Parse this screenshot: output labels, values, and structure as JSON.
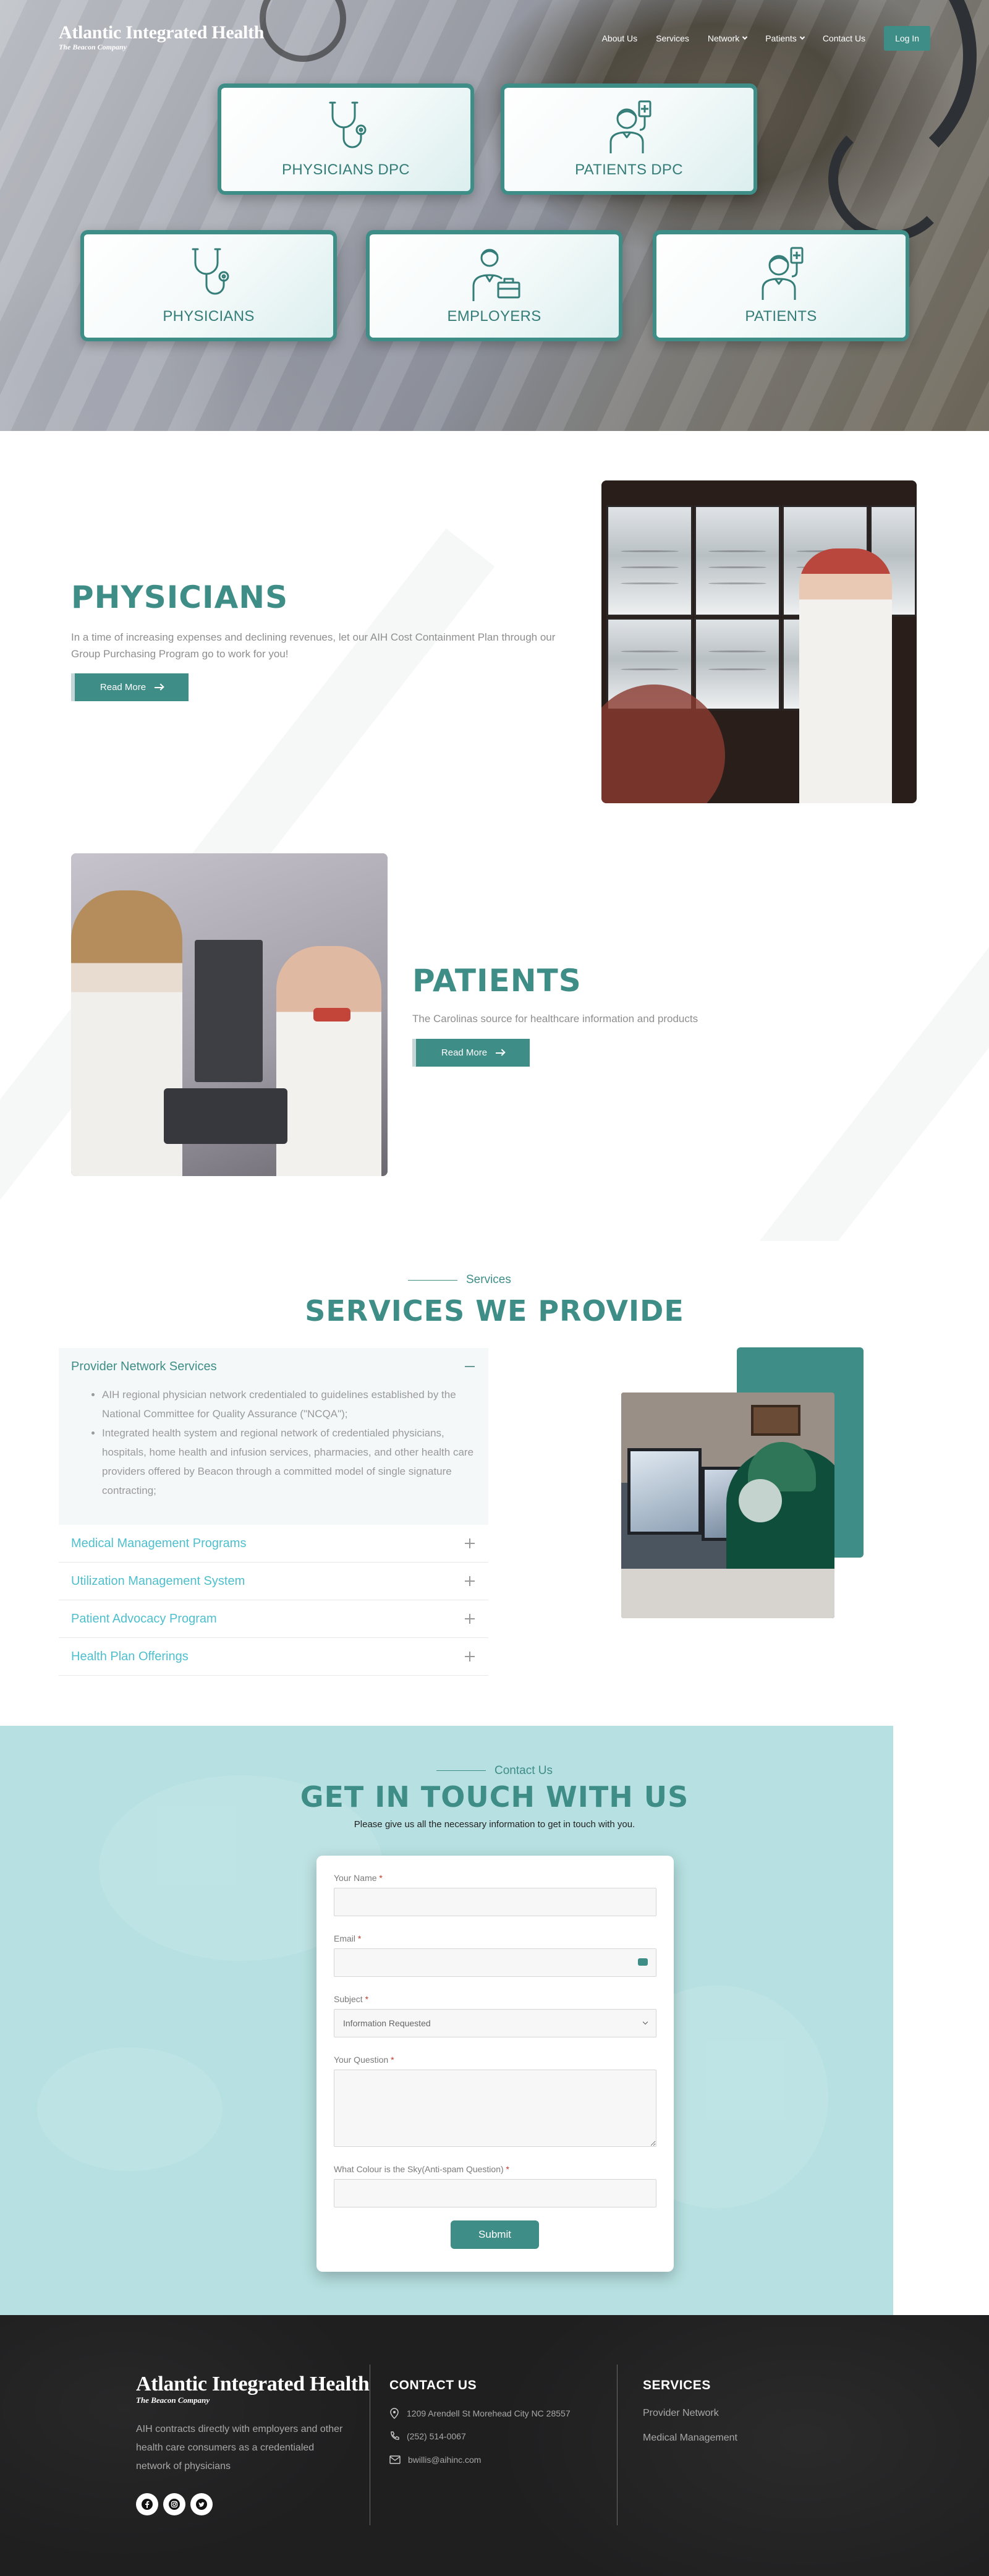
{
  "brand": {
    "name": "Atlantic Integrated Health",
    "tagline": "The Beacon Company"
  },
  "nav": {
    "items": [
      {
        "label": "About Us"
      },
      {
        "label": "Services"
      },
      {
        "label": "Network"
      },
      {
        "label": "Patients"
      },
      {
        "label": "Contact Us"
      }
    ],
    "login_label": "Log In"
  },
  "hero": {
    "cards": [
      {
        "label": "PHYSICIANS DPC",
        "icon": "stethoscope-icon"
      },
      {
        "label": "PATIENTS DPC",
        "icon": "patient-iv-icon"
      },
      {
        "label": "PHYSICIANS",
        "icon": "stethoscope-icon"
      },
      {
        "label": "EMPLOYERS",
        "icon": "employer-briefcase-icon"
      },
      {
        "label": "PATIENTS",
        "icon": "patient-iv-icon"
      }
    ]
  },
  "physicians": {
    "title": "PHYSICIANS",
    "text": "In a time of increasing expenses and declining revenues, let our AIH Cost Containment Plan through our Group Purchasing Program go to work for you!",
    "button": "Read More"
  },
  "patients": {
    "title": "PATIENTS",
    "text": "The Carolinas source for healthcare information and products",
    "button": "Read More"
  },
  "services": {
    "tag": "Services",
    "title": "SERVICES WE PROVIDE",
    "open_item": {
      "title": "Provider Network Services",
      "bullets": [
        "AIH regional physician network credentialed to guidelines established by the National Committee for Quality Assurance (\"NCQA\");",
        "Integrated health system and regional network of credentialed physicians, hospitals, home health and infusion services, pharmacies, and other health care providers offered by Beacon through a committed model of single signature contracting;"
      ]
    },
    "items": [
      {
        "title": "Medical Management Programs"
      },
      {
        "title": "Utilization Management System"
      },
      {
        "title": "Patient Advocacy Program"
      },
      {
        "title": "Health Plan Offerings"
      }
    ]
  },
  "contact": {
    "tag": "Contact Us",
    "title": "GET IN TOUCH WITH US",
    "desc": "Please give us all the necessary information to get in touch with you.",
    "fields": {
      "name_label": "Your Name",
      "email_label": "Email",
      "subject_label": "Subject",
      "subject_value": "Information Requested",
      "question_label": "Your Question",
      "antispam_label": "What Colour is the Sky(Anti-spam Question)",
      "required_mark": "*"
    },
    "submit": "Submit"
  },
  "footer": {
    "about": "AIH contracts directly with employers and other health care consumers as a credentialed network of physicians",
    "contact_title": "CONTACT US",
    "address": "1209 Arendell St Morehead City NC 28557",
    "phone": "(252) 514-0067",
    "email": "bwillis@aihinc.com",
    "services_title": "SERVICES",
    "services_links": [
      "Provider Network",
      "Medical Management"
    ],
    "social_icons": [
      "facebook-icon",
      "instagram-icon",
      "twitter-icon"
    ]
  },
  "colors": {
    "accent": "#3f8d87",
    "accordion_link": "#4ebfcd",
    "contact_bg": "#b6e0e1",
    "footer_bg": "#1f1f20"
  }
}
